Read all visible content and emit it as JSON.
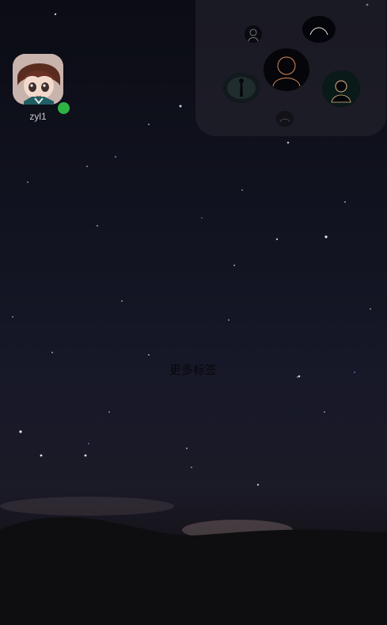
{
  "user": {
    "name": "zyl1",
    "online": true,
    "status_color": "#2fb344",
    "avatar_icon": "anime-avatar"
  },
  "bubbles": [
    {
      "name": "silhouette-bubble-small-top",
      "icon": "silhouette-icon"
    },
    {
      "name": "silhouette-bubble-right-top",
      "icon": "silhouette-icon"
    },
    {
      "name": "silhouette-bubble-center",
      "icon": "silhouette-icon"
    },
    {
      "name": "silhouette-bubble-left",
      "icon": "silhouette-icon"
    },
    {
      "name": "silhouette-bubble-right",
      "icon": "silhouette-icon"
    },
    {
      "name": "silhouette-bubble-small-bottom",
      "icon": "silhouette-icon"
    }
  ],
  "more_tags_label": "更多标签"
}
